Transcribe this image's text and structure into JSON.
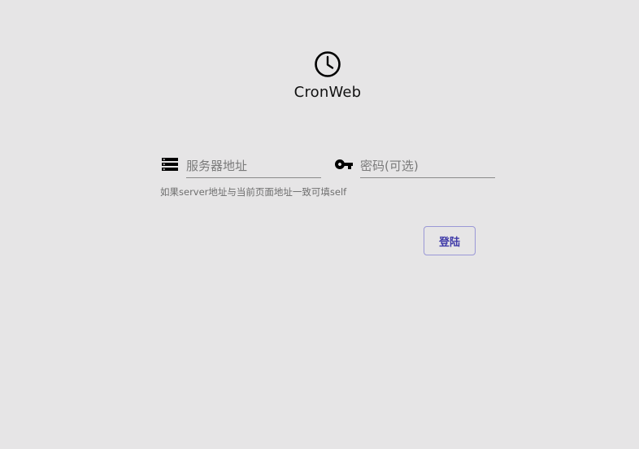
{
  "app": {
    "title": "CronWeb",
    "logo_icon": "clock-icon"
  },
  "form": {
    "server": {
      "icon": "server-icon",
      "placeholder": "服务器地址",
      "value": ""
    },
    "password": {
      "icon": "key-icon",
      "placeholder": "密码(可选)",
      "value": ""
    },
    "hint": "如果server地址与当前页面地址一致可填self",
    "login_label": "登陆"
  },
  "colors": {
    "background": "#e6e5e6",
    "accent": "#3f3aa8"
  }
}
